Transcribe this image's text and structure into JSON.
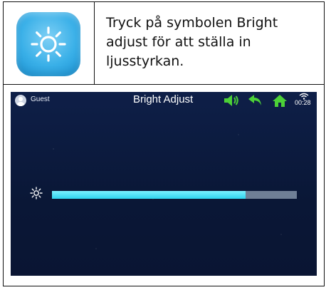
{
  "instruction": {
    "line1": "Tryck på symbolen Bright",
    "line2": "adjust för att ställa in",
    "line3": "ljusstyrkan."
  },
  "app_icon": {
    "icon": "sun-icon",
    "color": "#3ab0e8"
  },
  "device_screen": {
    "user_label": "Guest",
    "title": "Bright Adjust",
    "status_icons": [
      "volume-icon",
      "back-icon",
      "home-icon",
      "wifi-icon"
    ],
    "time": "00:28",
    "brightness": {
      "icon": "sun-icon",
      "level_percent": 79,
      "fill_color": "#2fd3ee",
      "track_color": "#6f7f96"
    },
    "colors": {
      "background": "#0b1a3d",
      "icons": "#4cd137"
    }
  }
}
